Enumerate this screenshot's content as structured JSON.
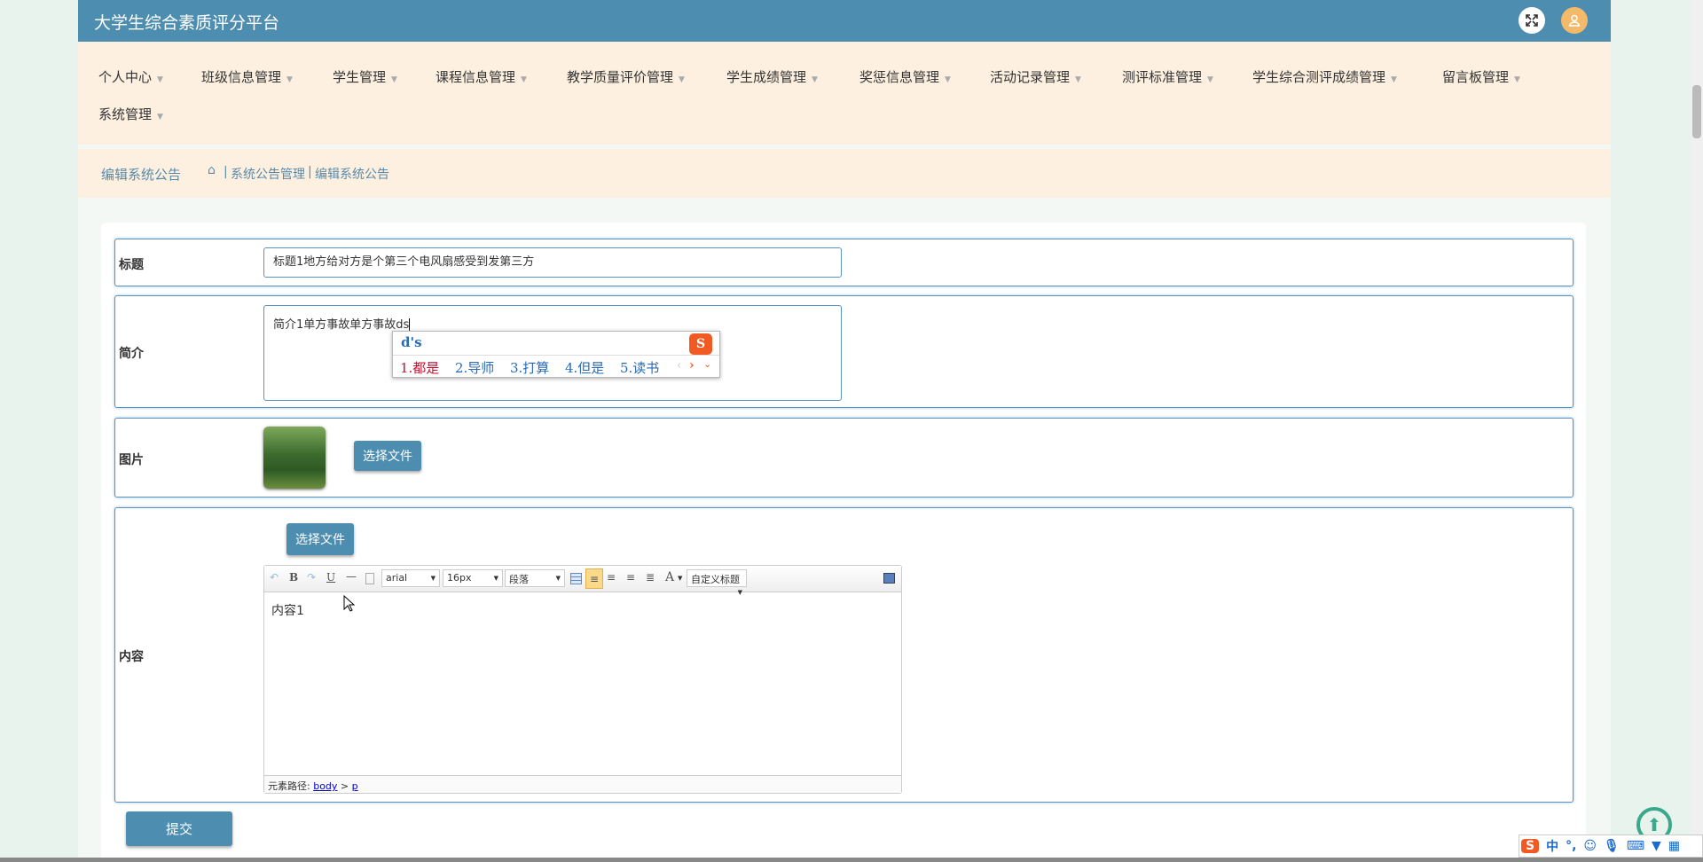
{
  "header": {
    "title": "大学生综合素质评分平台"
  },
  "nav": [
    "个人中心",
    "班级信息管理",
    "学生管理",
    "课程信息管理",
    "教学质量评价管理",
    "学生成绩管理",
    "奖惩信息管理",
    "活动记录管理",
    "测评标准管理",
    "学生综合测评成绩管理",
    "留言板管理",
    "系统管理"
  ],
  "breadcrumb": {
    "page": "编辑系统公告",
    "sep": "|",
    "items": [
      "系统公告管理",
      "编辑系统公告"
    ]
  },
  "form": {
    "title_label": "标题",
    "title_value": "标题1地方给对方是个第三个电风扇感受到发第三方",
    "intro_label": "简介",
    "intro_value": "简介1单方事故单方事故ds",
    "image_label": "图片",
    "choose_file": "选择文件",
    "content_label": "内容",
    "content_value": "内容1",
    "submit": "提交"
  },
  "editor": {
    "font": "arial",
    "size": "16px",
    "paragraph": "段落",
    "custom_title": "自定义标题",
    "path_label": "元素路径:",
    "path": [
      "body",
      "p"
    ],
    "bold": "B",
    "underline": "U",
    "fontcolor": "A"
  },
  "ime": {
    "input": "d's",
    "candidates": [
      "1.都是",
      "2.导师",
      "3.打算",
      "4.但是",
      "5.读书"
    ]
  },
  "imebar": {
    "mode": "中",
    "punct": "°,"
  }
}
